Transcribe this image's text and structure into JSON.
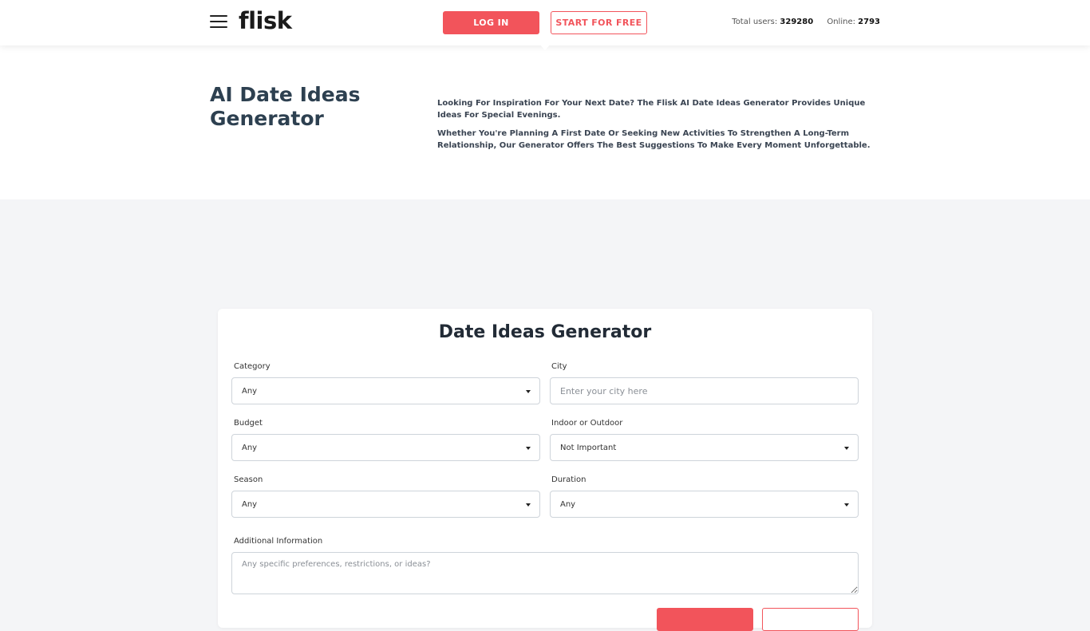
{
  "header": {
    "logo": "flisk",
    "login_label": "LOG IN",
    "start_label": "START FOR FREE",
    "total_users_label": "Total users:",
    "total_users_value": "329280",
    "online_label": "Online:",
    "online_value": "2793"
  },
  "intro": {
    "title": "AI Date Ideas Generator",
    "paragraph1": "Looking For Inspiration For Your Next Date? The Flisk AI Date Ideas Generator Provides Unique Ideas For Special Evenings.",
    "paragraph2": "Whether You're Planning A First Date Or Seeking New Activities To Strengthen A Long-Term Relationship, Our Generator Offers The Best Suggestions To Make Every Moment Unforgettable."
  },
  "form": {
    "title": "Date Ideas Generator",
    "category": {
      "label": "Category",
      "value": "Any"
    },
    "city": {
      "label": "City",
      "placeholder": "Enter your city here"
    },
    "budget": {
      "label": "Budget",
      "value": "Any"
    },
    "indoor_outdoor": {
      "label": "Indoor or Outdoor",
      "value": "Not Important"
    },
    "season": {
      "label": "Season",
      "value": "Any"
    },
    "duration": {
      "label": "Duration",
      "value": "Any"
    },
    "additional": {
      "label": "Additional Information",
      "placeholder": "Any specific preferences, restrictions, or ideas?"
    }
  },
  "colors": {
    "accent": "#f2545b",
    "page_bg": "#f4f5f7",
    "card_bg": "#ffffff"
  }
}
